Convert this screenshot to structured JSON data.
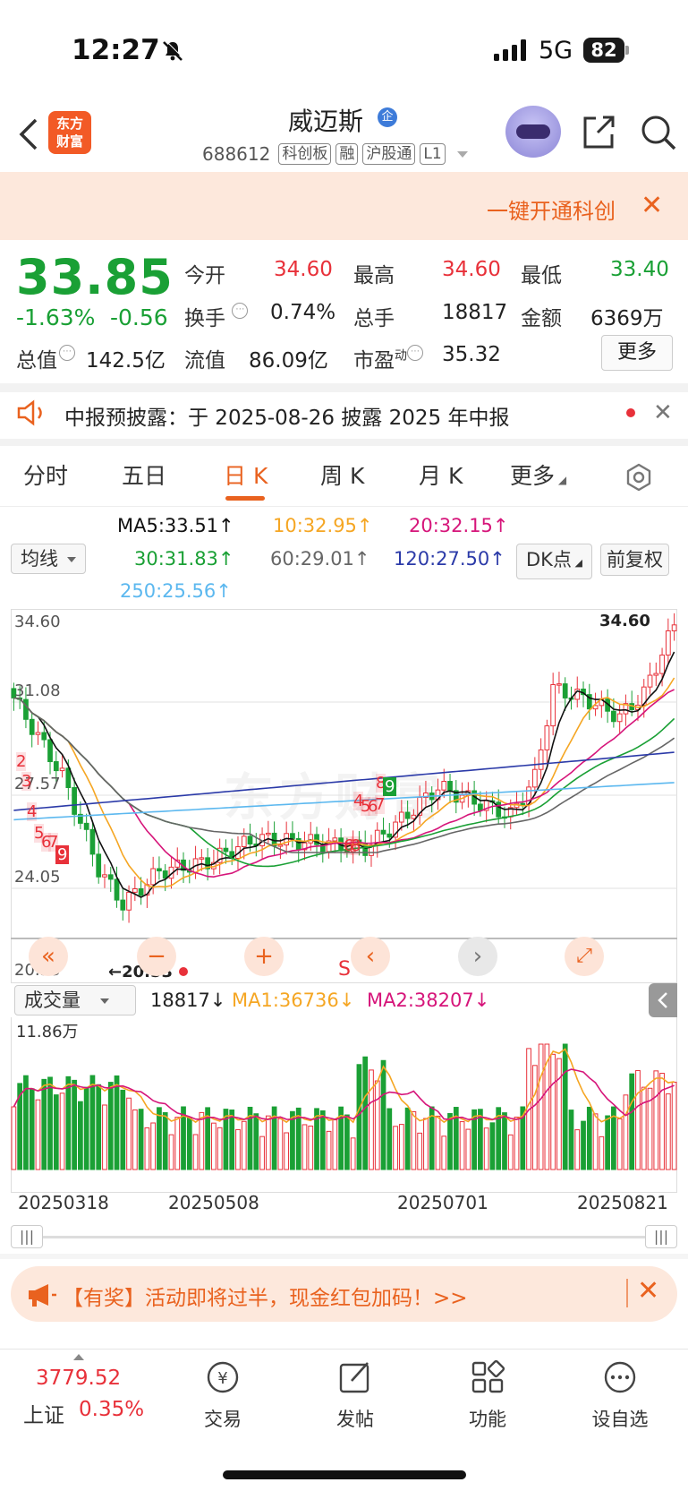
{
  "status_bar": {
    "time": "12:27",
    "network": "5G",
    "battery": "82"
  },
  "header": {
    "app_logo": "东方\n财富",
    "stock_name": "威迈斯",
    "qi_badge": "企",
    "code": "688612",
    "tags": [
      "科创板",
      "融",
      "沪股通",
      "L1"
    ]
  },
  "banner": {
    "text": "一键开通科创",
    "close": "✕"
  },
  "quote": {
    "price": "33.85",
    "change_pct": "-1.63%",
    "change": "-0.56",
    "open_label": "今开",
    "open": "34.60",
    "high_label": "最高",
    "high": "34.60",
    "low_label": "最低",
    "low": "33.40",
    "turnover_label": "换手",
    "turnover": "0.74%",
    "volume_label": "总手",
    "volume": "18817",
    "amount_label": "金额",
    "amount": "6369万",
    "mktcap_label": "总值",
    "mktcap": "142.5亿",
    "float_label": "流值",
    "float_cap": "86.09亿",
    "pe_label": "市盈",
    "pe_sup": "动",
    "pe": "35.32",
    "more": "更多"
  },
  "notice": {
    "text": "中报预披露：于 2025-08-26 披露 2025 年中报",
    "close": "✕"
  },
  "tabs": [
    "分时",
    "五日",
    "日 K",
    "周 K",
    "月 K",
    "更多"
  ],
  "active_tab": "日 K",
  "ma_legend": {
    "ma5": "MA5:33.51↑",
    "ma10": "10:32.95↑",
    "ma20": "20:32.15↑",
    "ma30": "30:31.83↑",
    "ma60": "60:29.01↑",
    "ma120": "120:27.50↑",
    "ma250": "250:25.56↑",
    "selector": "均线",
    "dk_button": "DK点",
    "adjust_button": "前复权"
  },
  "price_axis": {
    "top": "34.60",
    "l2": "31.08",
    "l3": "27.57",
    "l4": "24.05",
    "bottom": "20.53"
  },
  "price_markers": {
    "max_label": "34.60",
    "min_label": "←20.53"
  },
  "chart_badges": {
    "s_label": "S",
    "b1": "2",
    "b2": "3",
    "b3": "4",
    "b4": "5",
    "b5": "6",
    "b6": "7",
    "b7": "9",
    "b8": "8",
    "b9": "9",
    "b10": "4",
    "b11": "5",
    "b12": "6",
    "b13": "7",
    "b14": "6",
    "b15": "8"
  },
  "chart_watermark": "东方财富",
  "controls": {
    "rewind": "«",
    "zoom_out": "−",
    "zoom_in": "+",
    "prev": "‹",
    "next": "›",
    "expand": "⤢"
  },
  "volume": {
    "selector": "成交量",
    "value": "18817↓",
    "ma1": "MA1:36736↓",
    "ma2": "MA2:38207↓",
    "axis_top": "11.86万"
  },
  "dates": [
    "20250318",
    "20250508",
    "20250701",
    "20250821"
  ],
  "promo": {
    "text": "【有奖】活动即将过半，现金红包加码！>>",
    "close": "✕"
  },
  "bottom_nav": {
    "index_value": "3779.52",
    "index_name": "上证",
    "index_pct": "0.35%",
    "items": [
      "交易",
      "发帖",
      "功能",
      "设自选"
    ]
  },
  "colors": {
    "up": "#e8313a",
    "down": "#1aa035",
    "accent": "#e9621f"
  }
}
